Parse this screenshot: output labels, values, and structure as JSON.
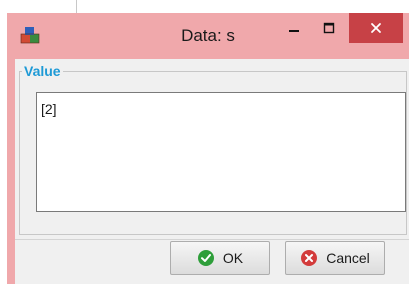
{
  "window": {
    "title": "Data: s",
    "app_icon": "cubes-icon",
    "frame_color": "#f0a8ab",
    "close_color": "#c74146"
  },
  "value_group": {
    "label": "Value",
    "label_color": "#1e9ad6",
    "value_text": "[2]"
  },
  "buttons": {
    "ok_label": "OK",
    "ok_icon": "check-circle-icon",
    "ok_icon_color": "#2e9e3a",
    "cancel_label": "Cancel",
    "cancel_icon": "x-circle-icon",
    "cancel_icon_color": "#d33b3b"
  }
}
